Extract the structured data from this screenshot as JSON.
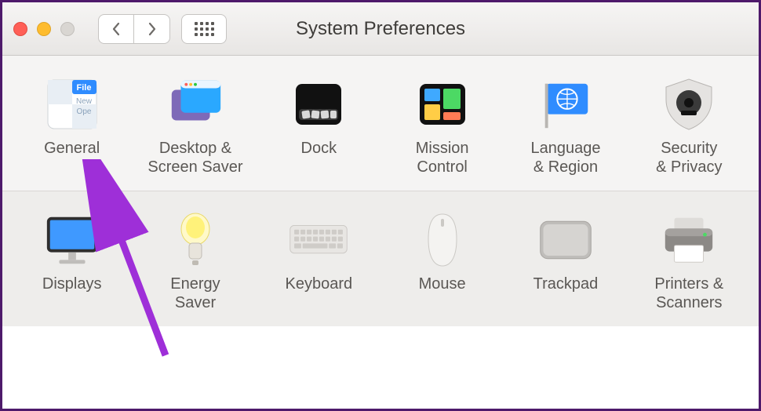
{
  "window": {
    "title": "System Preferences"
  },
  "rows": [
    {
      "items": [
        {
          "name": "general",
          "label": "General"
        },
        {
          "name": "desktop-screen-saver",
          "label": "Desktop &\nScreen Saver"
        },
        {
          "name": "dock",
          "label": "Dock"
        },
        {
          "name": "mission-control",
          "label": "Mission\nControl"
        },
        {
          "name": "language-region",
          "label": "Language\n& Region"
        },
        {
          "name": "security-privacy",
          "label": "Security\n& Privacy"
        }
      ]
    },
    {
      "items": [
        {
          "name": "displays",
          "label": "Displays"
        },
        {
          "name": "energy-saver",
          "label": "Energy\nSaver"
        },
        {
          "name": "keyboard",
          "label": "Keyboard"
        },
        {
          "name": "mouse",
          "label": "Mouse"
        },
        {
          "name": "trackpad",
          "label": "Trackpad"
        },
        {
          "name": "printers-scanners",
          "label": "Printers &\nScanners"
        }
      ]
    }
  ],
  "annotation": {
    "target": "general",
    "color": "#9e2fd8"
  }
}
